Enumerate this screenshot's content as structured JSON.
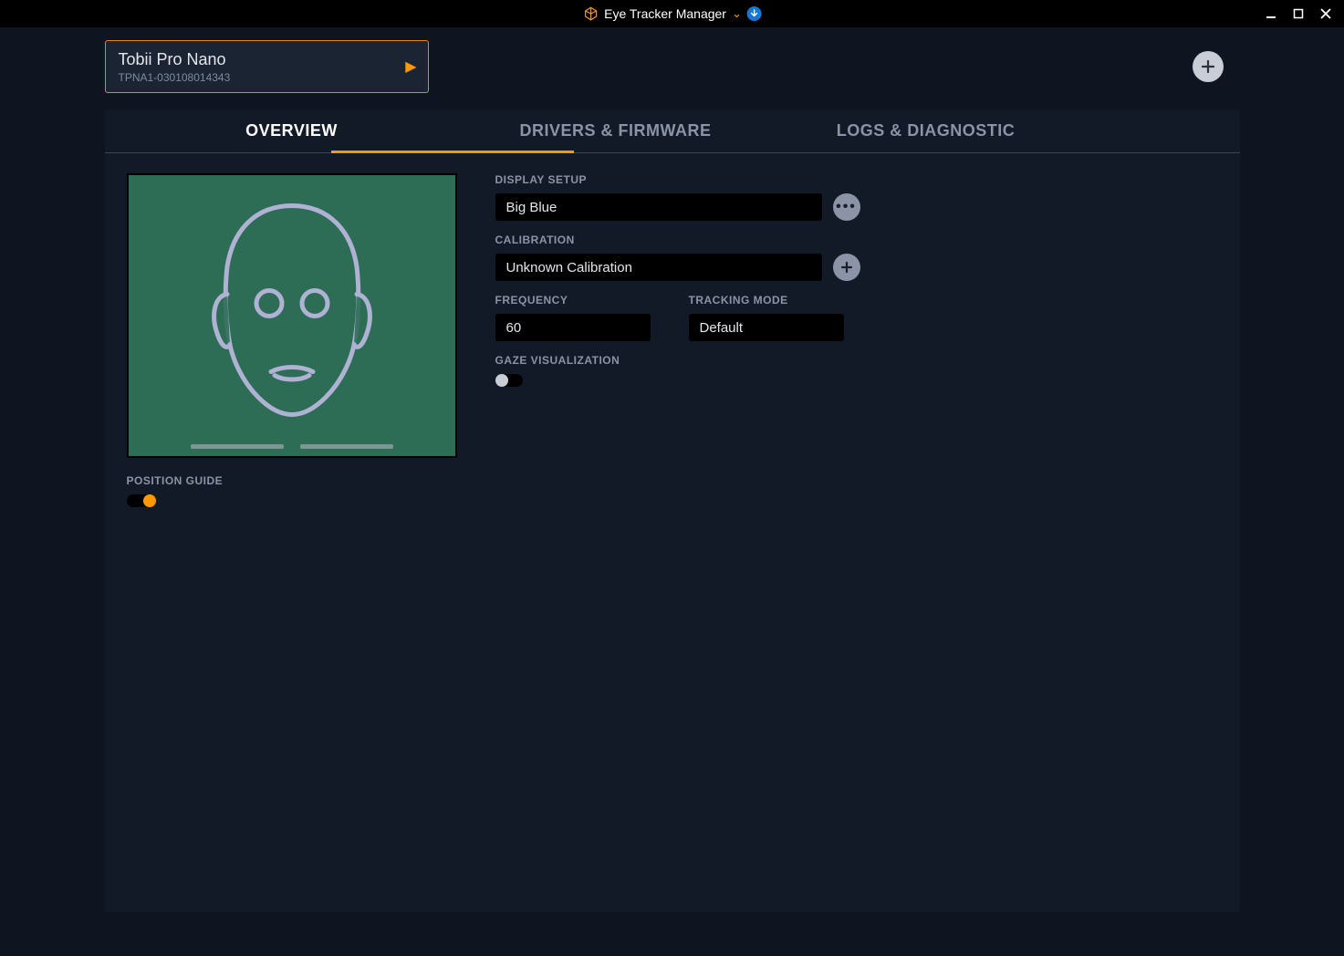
{
  "titlebar": {
    "title": "Eye Tracker Manager"
  },
  "device": {
    "name": "Tobii Pro Nano",
    "serial": "TPNA1-030108014343"
  },
  "tabs": {
    "overview": "OVERVIEW",
    "drivers": "DRIVERS & FIRMWARE",
    "logs": "LOGS & DIAGNOSTIC"
  },
  "sections": {
    "display_setup": "DISPLAY SETUP",
    "calibration": "CALIBRATION",
    "frequency": "FREQUENCY",
    "tracking_mode": "TRACKING MODE",
    "gaze_viz": "GAZE VISUALIZATION",
    "position_guide": "POSITION GUIDE"
  },
  "values": {
    "display_setup": "Big Blue",
    "calibration": "Unknown Calibration",
    "frequency": "60",
    "tracking_mode": "Default"
  },
  "toggles": {
    "gaze_viz": "off",
    "position_guide": "on"
  }
}
